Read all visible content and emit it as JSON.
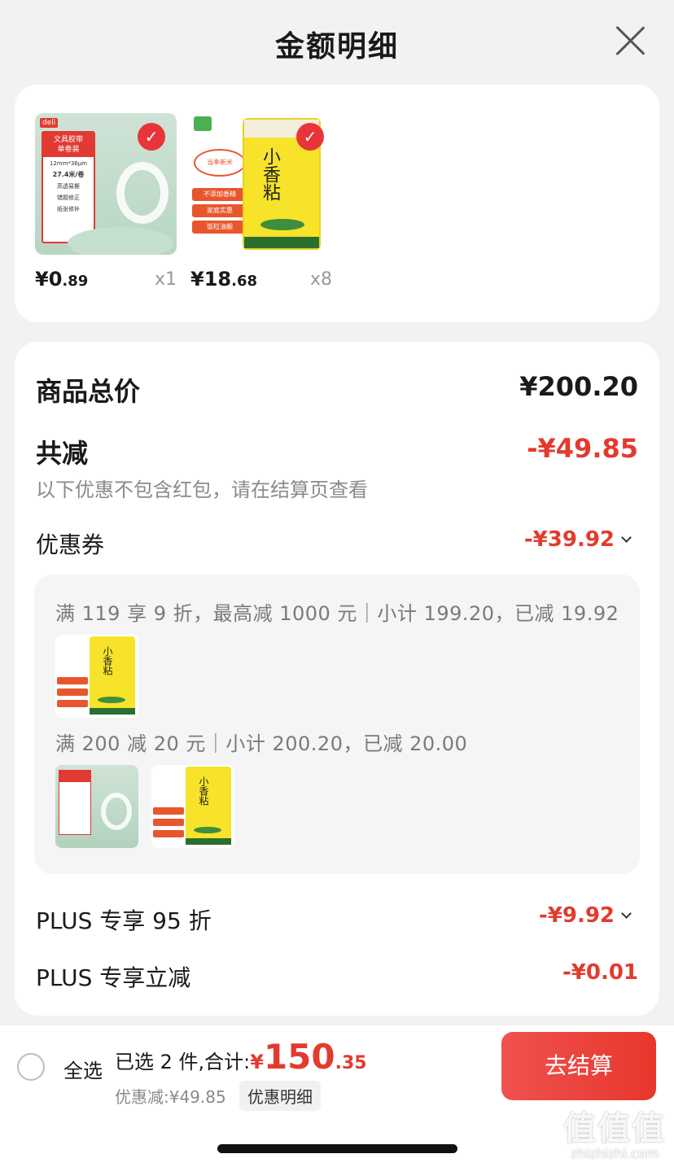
{
  "header": {
    "title": "金额明细"
  },
  "products": [
    {
      "price_int": "¥0",
      "price_cents": ".89",
      "qty": "x1",
      "brand": "deli",
      "label_title": "文具胶带\n单卷装",
      "label_lines": [
        "12mm*36μm",
        "27.4米/卷",
        "高透易撕",
        "错题修正",
        "纸张修补"
      ]
    },
    {
      "price_int": "¥18",
      "price_cents": ".68",
      "qty": "x8",
      "bag_name": "小香粘",
      "badge": "当季新米",
      "tags": [
        "不添加香精",
        "家庭实惠",
        "饭粒油靓"
      ]
    }
  ],
  "detail": {
    "total_label": "商品总价",
    "total_value": "¥200.20",
    "reduce_label": "共减",
    "reduce_value": "-¥49.85",
    "note": "以下优惠不包含红包，请在结算页查看",
    "coupon_label": "优惠券",
    "coupon_value": "-¥39.92",
    "coupons": [
      {
        "text": "满 119 享 9 折，最高减 1000 元｜小计 199.20，已减 19.92"
      },
      {
        "text": "满 200 减 20 元｜小计 200.20，已减 20.00"
      }
    ],
    "plus95_label": "PLUS 专享 95 折",
    "plus95_value": "-¥9.92",
    "plus_reduce_label": "PLUS 专享立减",
    "plus_reduce_value": "-¥0.01"
  },
  "bottom": {
    "select_all": "全选",
    "selected_text": "已选 2 件,合计:",
    "total_yen": "¥",
    "total_int": "150",
    "total_cents": ".35",
    "discount_text": "优惠减:¥49.85",
    "detail_chip": "优惠明细",
    "checkout": "去结算"
  },
  "watermark": {
    "logo": "值值值",
    "url": "zhizhizhi.com"
  },
  "colors": {
    "accent_red": "#e23b2e",
    "button_red": "#e7372c"
  }
}
